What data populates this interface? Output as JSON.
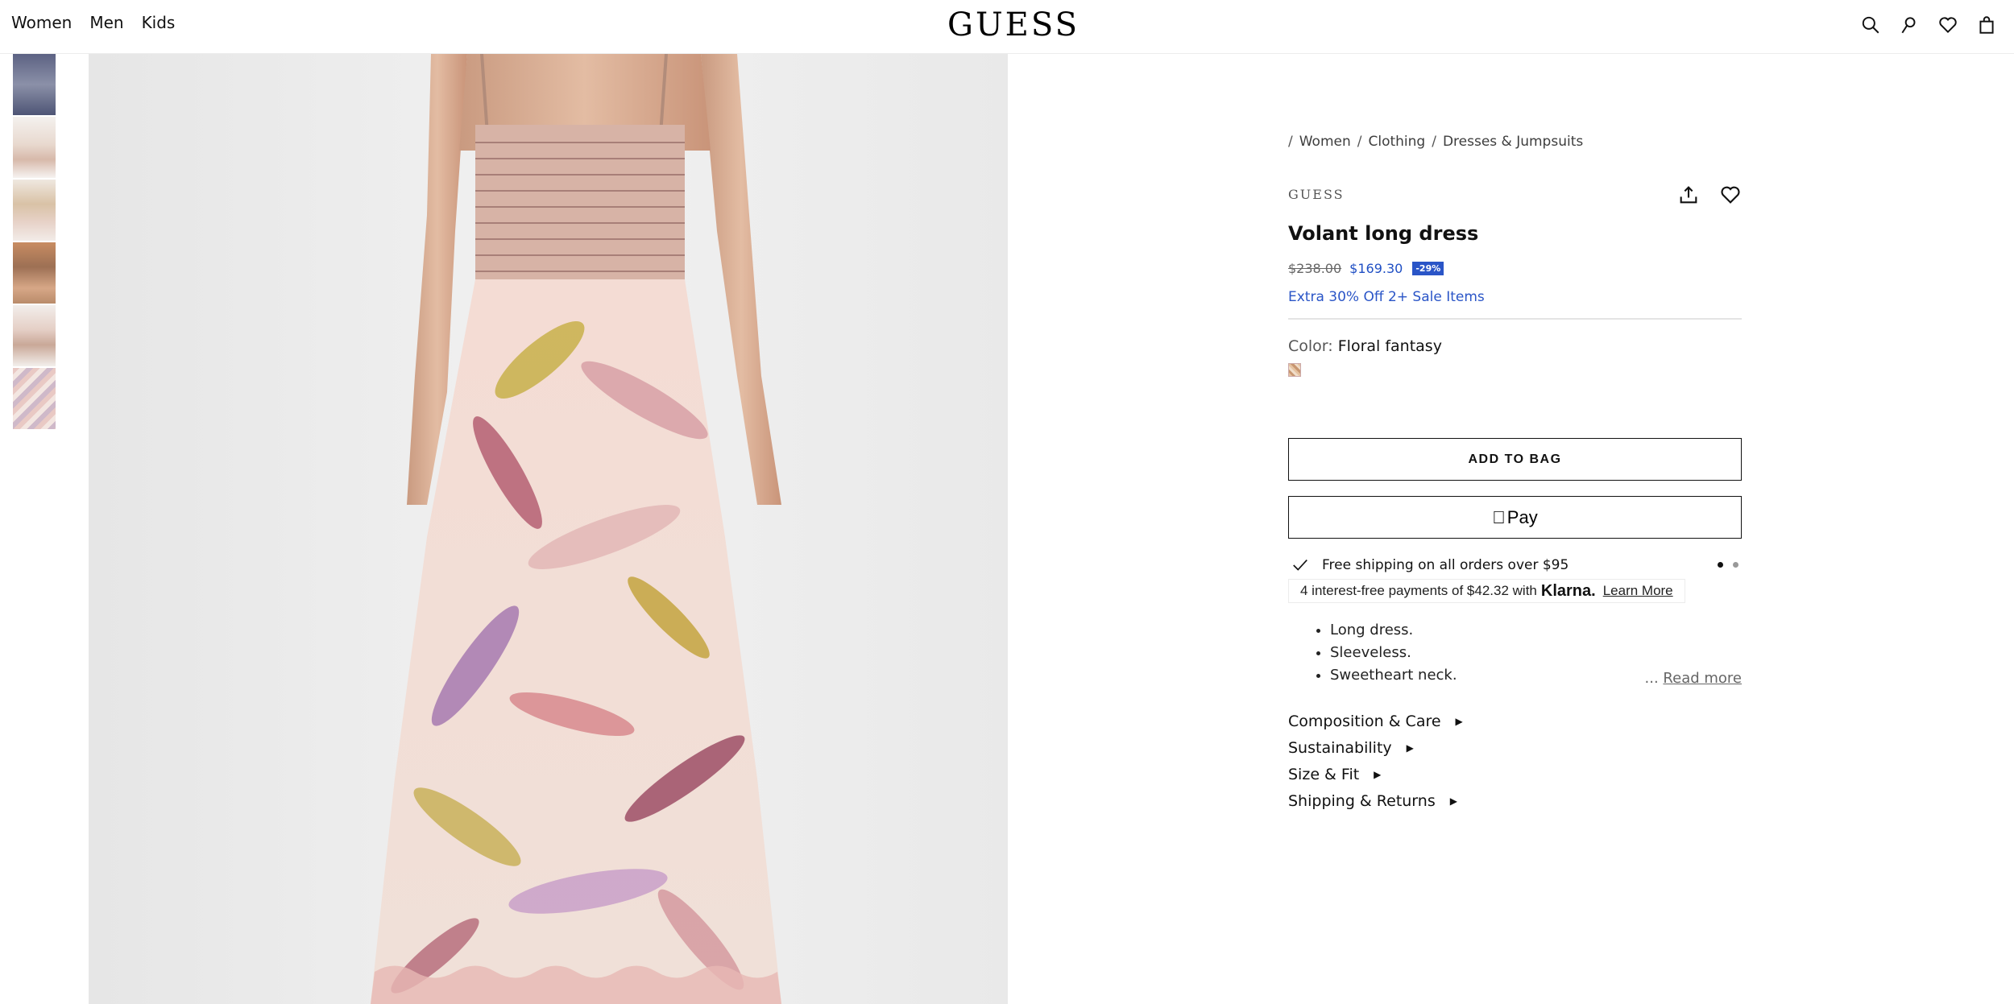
{
  "header": {
    "nav": [
      "Women",
      "Men",
      "Kids"
    ],
    "logo": "GUESS",
    "icons": [
      "search-icon",
      "account-icon",
      "wishlist-icon",
      "bag-icon"
    ]
  },
  "gallery": {
    "thumbnail_count": 6
  },
  "breadcrumb": [
    {
      "label": "Women"
    },
    {
      "label": "Clothing"
    },
    {
      "label": "Dresses & Jumpsuits"
    }
  ],
  "product": {
    "brand": "GUESS",
    "title": "Volant long dress",
    "price_original": "$238.00",
    "price_sale": "$169.30",
    "discount": "-29%",
    "promo": "Extra 30% Off 2+ Sale Items",
    "color_label": "Color:",
    "color_value": "Floral fantasy"
  },
  "actions": {
    "add_to_bag": "ADD TO BAG",
    "apple_pay": "Pay"
  },
  "shipping": {
    "message": "Free shipping on all orders over $95"
  },
  "klarna": {
    "prefix": "4 interest-free payments of $42.32 with",
    "brand": "Klarna.",
    "link": "Learn More"
  },
  "description": {
    "items": [
      "Long dress.",
      "Sleeveless.",
      "Sweetheart neck."
    ],
    "ellipsis": "...",
    "read_more": "Read more"
  },
  "accordions": [
    "Composition & Care",
    "Sustainability",
    "Size & Fit",
    "Shipping & Returns"
  ],
  "colors": {
    "sale_blue": "#2a55c7",
    "text": "#111111"
  }
}
